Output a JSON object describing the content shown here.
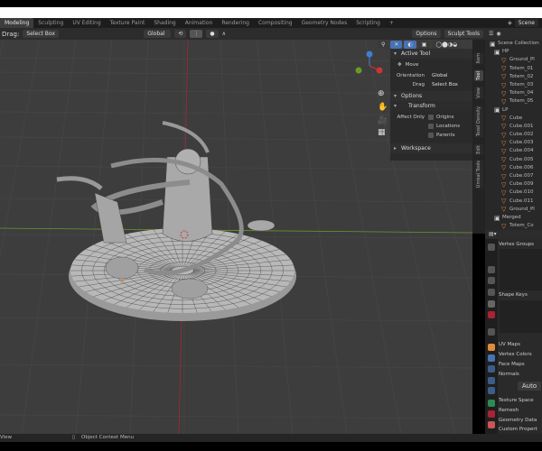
{
  "workspaces": [
    "Modeling",
    "Sculpting",
    "UV Editing",
    "Texture Paint",
    "Shading",
    "Animation",
    "Rendering",
    "Compositing",
    "Geometry Nodes",
    "Scripting"
  ],
  "add_tab": "+",
  "scene": "Scene",
  "header": {
    "drag_label": "Drag:",
    "drag_value": "Select Box",
    "orientation": "Global",
    "options": "Options",
    "sculpt_tools": "Sculpt Tools"
  },
  "npanel": {
    "active_tool": "Active Tool",
    "move": "Move",
    "orientation_label": "Orientation",
    "orientation_value": "Global",
    "drag_label": "Drag",
    "drag_value": "Select Box",
    "options": "Options",
    "transform": "Transform",
    "affect_only": "Affect Only",
    "origins": "Origins",
    "locations": "Locations",
    "parents": "Parents",
    "workspace": "Workspace"
  },
  "vtabs": [
    "Item",
    "Tool",
    "View",
    "Texel Density",
    "Edit",
    "Unreal Tools"
  ],
  "outliner": {
    "root": "Scene Collection",
    "items": [
      {
        "name": "HP",
        "type": "collection",
        "level": 1
      },
      {
        "name": "Ground_Pl",
        "type": "mesh",
        "level": 2
      },
      {
        "name": "Totem_01",
        "type": "mesh",
        "level": 2
      },
      {
        "name": "Totem_02",
        "type": "mesh",
        "level": 2
      },
      {
        "name": "Totem_03",
        "type": "mesh",
        "level": 2
      },
      {
        "name": "Totem_04",
        "type": "mesh",
        "level": 2
      },
      {
        "name": "Totem_05",
        "type": "mesh",
        "level": 2
      },
      {
        "name": "LP",
        "type": "collection",
        "level": 1
      },
      {
        "name": "Cube",
        "type": "mesh",
        "level": 2
      },
      {
        "name": "Cube.001",
        "type": "mesh",
        "level": 2
      },
      {
        "name": "Cube.002",
        "type": "mesh",
        "level": 2
      },
      {
        "name": "Cube.003",
        "type": "mesh",
        "level": 2
      },
      {
        "name": "Cube.004",
        "type": "mesh",
        "level": 2
      },
      {
        "name": "Cube.005",
        "type": "mesh",
        "level": 2
      },
      {
        "name": "Cube.006",
        "type": "mesh",
        "level": 2
      },
      {
        "name": "Cube.007",
        "type": "mesh",
        "level": 2
      },
      {
        "name": "Cube.009",
        "type": "mesh",
        "level": 2
      },
      {
        "name": "Cube.010",
        "type": "mesh",
        "level": 2
      },
      {
        "name": "Cube.011",
        "type": "mesh",
        "level": 2
      },
      {
        "name": "Ground_Pl",
        "type": "mesh",
        "level": 2
      },
      {
        "name": "Merged",
        "type": "collection",
        "level": 1
      },
      {
        "name": "Totem_Co",
        "type": "mesh",
        "level": 2
      }
    ]
  },
  "properties": {
    "vertex_groups": "Vertex Groups",
    "shape_keys": "Shape Keys",
    "uv_maps": "UV Maps",
    "vertex_colors": "Vertex Colors",
    "face_maps": "Face Maps",
    "normals": "Normals",
    "auto_smooth": "Auto",
    "texture_space": "Texture Space",
    "remesh": "Remesh",
    "geometry_data": "Geometry Data",
    "custom_properties": "Custom Propert"
  },
  "status": {
    "left": "View",
    "context": "Object Context Menu"
  },
  "colors": {
    "accent": "#4772b3",
    "x_axis": "#a0283a",
    "y_axis": "#6a9a26",
    "mesh": "#e08b3a"
  }
}
